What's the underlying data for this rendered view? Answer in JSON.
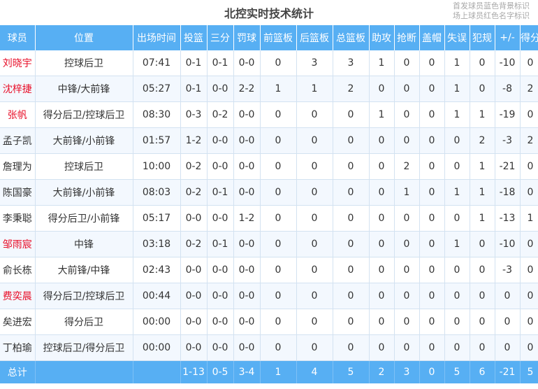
{
  "title": "北控实时技术统计",
  "legend": [
    "首发球员蓝色背景标识",
    "场上球员红色名字标识"
  ],
  "columns": [
    "球员",
    "位置",
    "出场时间",
    "投篮",
    "三分",
    "罚球",
    "前篮板",
    "后篮板",
    "总篮板",
    "助攻",
    "抢断",
    "盖帽",
    "失误",
    "犯规",
    "+/-",
    "得分"
  ],
  "rows": [
    {
      "name": "刘晓宇",
      "pos": "控球后卫",
      "min": "07:41",
      "fg": "0-1",
      "tp": "0-1",
      "ft": "0-0",
      "or": "0",
      "dr": "3",
      "tr": "3",
      "ast": "1",
      "stl": "0",
      "blk": "0",
      "to": "1",
      "pf": "0",
      "pm": "-10",
      "pts": "0",
      "on_court": true
    },
    {
      "name": "沈梓捷",
      "pos": "中锋/大前锋",
      "min": "05:27",
      "fg": "0-1",
      "tp": "0-0",
      "ft": "2-2",
      "or": "1",
      "dr": "1",
      "tr": "2",
      "ast": "0",
      "stl": "0",
      "blk": "0",
      "to": "1",
      "pf": "0",
      "pm": "-8",
      "pts": "2",
      "on_court": true
    },
    {
      "name": "张帆",
      "pos": "得分后卫/控球后卫",
      "min": "08:30",
      "fg": "0-3",
      "tp": "0-2",
      "ft": "0-0",
      "or": "0",
      "dr": "0",
      "tr": "0",
      "ast": "1",
      "stl": "0",
      "blk": "0",
      "to": "1",
      "pf": "1",
      "pm": "-19",
      "pts": "0",
      "on_court": true
    },
    {
      "name": "孟子凯",
      "pos": "大前锋/小前锋",
      "min": "01:57",
      "fg": "1-2",
      "tp": "0-0",
      "ft": "0-0",
      "or": "0",
      "dr": "0",
      "tr": "0",
      "ast": "0",
      "stl": "0",
      "blk": "0",
      "to": "0",
      "pf": "2",
      "pm": "-3",
      "pts": "2",
      "on_court": false
    },
    {
      "name": "詹理为",
      "pos": "控球后卫",
      "min": "10:00",
      "fg": "0-2",
      "tp": "0-0",
      "ft": "0-0",
      "or": "0",
      "dr": "0",
      "tr": "0",
      "ast": "0",
      "stl": "2",
      "blk": "0",
      "to": "0",
      "pf": "1",
      "pm": "-21",
      "pts": "0",
      "on_court": false
    },
    {
      "name": "陈国豪",
      "pos": "大前锋/小前锋",
      "min": "08:03",
      "fg": "0-2",
      "tp": "0-1",
      "ft": "0-0",
      "or": "0",
      "dr": "0",
      "tr": "0",
      "ast": "0",
      "stl": "1",
      "blk": "0",
      "to": "1",
      "pf": "1",
      "pm": "-18",
      "pts": "0",
      "on_court": false
    },
    {
      "name": "李秉聪",
      "pos": "得分后卫/小前锋",
      "min": "05:17",
      "fg": "0-0",
      "tp": "0-0",
      "ft": "1-2",
      "or": "0",
      "dr": "0",
      "tr": "0",
      "ast": "0",
      "stl": "0",
      "blk": "0",
      "to": "0",
      "pf": "1",
      "pm": "-13",
      "pts": "1",
      "on_court": false
    },
    {
      "name": "邹雨宸",
      "pos": "中锋",
      "min": "03:18",
      "fg": "0-2",
      "tp": "0-1",
      "ft": "0-0",
      "or": "0",
      "dr": "0",
      "tr": "0",
      "ast": "0",
      "stl": "0",
      "blk": "0",
      "to": "1",
      "pf": "0",
      "pm": "-10",
      "pts": "0",
      "on_court": true
    },
    {
      "name": "俞长栋",
      "pos": "大前锋/中锋",
      "min": "02:43",
      "fg": "0-0",
      "tp": "0-0",
      "ft": "0-0",
      "or": "0",
      "dr": "0",
      "tr": "0",
      "ast": "0",
      "stl": "0",
      "blk": "0",
      "to": "0",
      "pf": "0",
      "pm": "-3",
      "pts": "0",
      "on_court": false
    },
    {
      "name": "费奕晨",
      "pos": "得分后卫/控球后卫",
      "min": "00:44",
      "fg": "0-0",
      "tp": "0-0",
      "ft": "0-0",
      "or": "0",
      "dr": "0",
      "tr": "0",
      "ast": "0",
      "stl": "0",
      "blk": "0",
      "to": "0",
      "pf": "0",
      "pm": "0",
      "pts": "0",
      "on_court": true
    },
    {
      "name": "矣进宏",
      "pos": "得分后卫",
      "min": "00:00",
      "fg": "0-0",
      "tp": "0-0",
      "ft": "0-0",
      "or": "0",
      "dr": "0",
      "tr": "0",
      "ast": "0",
      "stl": "0",
      "blk": "0",
      "to": "0",
      "pf": "0",
      "pm": "0",
      "pts": "0",
      "on_court": false
    },
    {
      "name": "丁柏瑜",
      "pos": "控球后卫/得分后卫",
      "min": "00:00",
      "fg": "0-0",
      "tp": "0-0",
      "ft": "0-0",
      "or": "0",
      "dr": "0",
      "tr": "0",
      "ast": "0",
      "stl": "0",
      "blk": "0",
      "to": "0",
      "pf": "0",
      "pm": "0",
      "pts": "0",
      "on_court": false
    }
  ],
  "total": {
    "label": "总计",
    "pos": "",
    "min": "",
    "fg": "1-13",
    "tp": "0-5",
    "ft": "3-4",
    "or": "1",
    "dr": "4",
    "tr": "5",
    "ast": "2",
    "stl": "3",
    "blk": "0",
    "to": "5",
    "pf": "6",
    "pm": "-21",
    "pts": "5"
  },
  "colors": {
    "header_bg": "#57aff3",
    "on_court_name": "#e8102a",
    "row_alt": "#f3f8fe"
  }
}
